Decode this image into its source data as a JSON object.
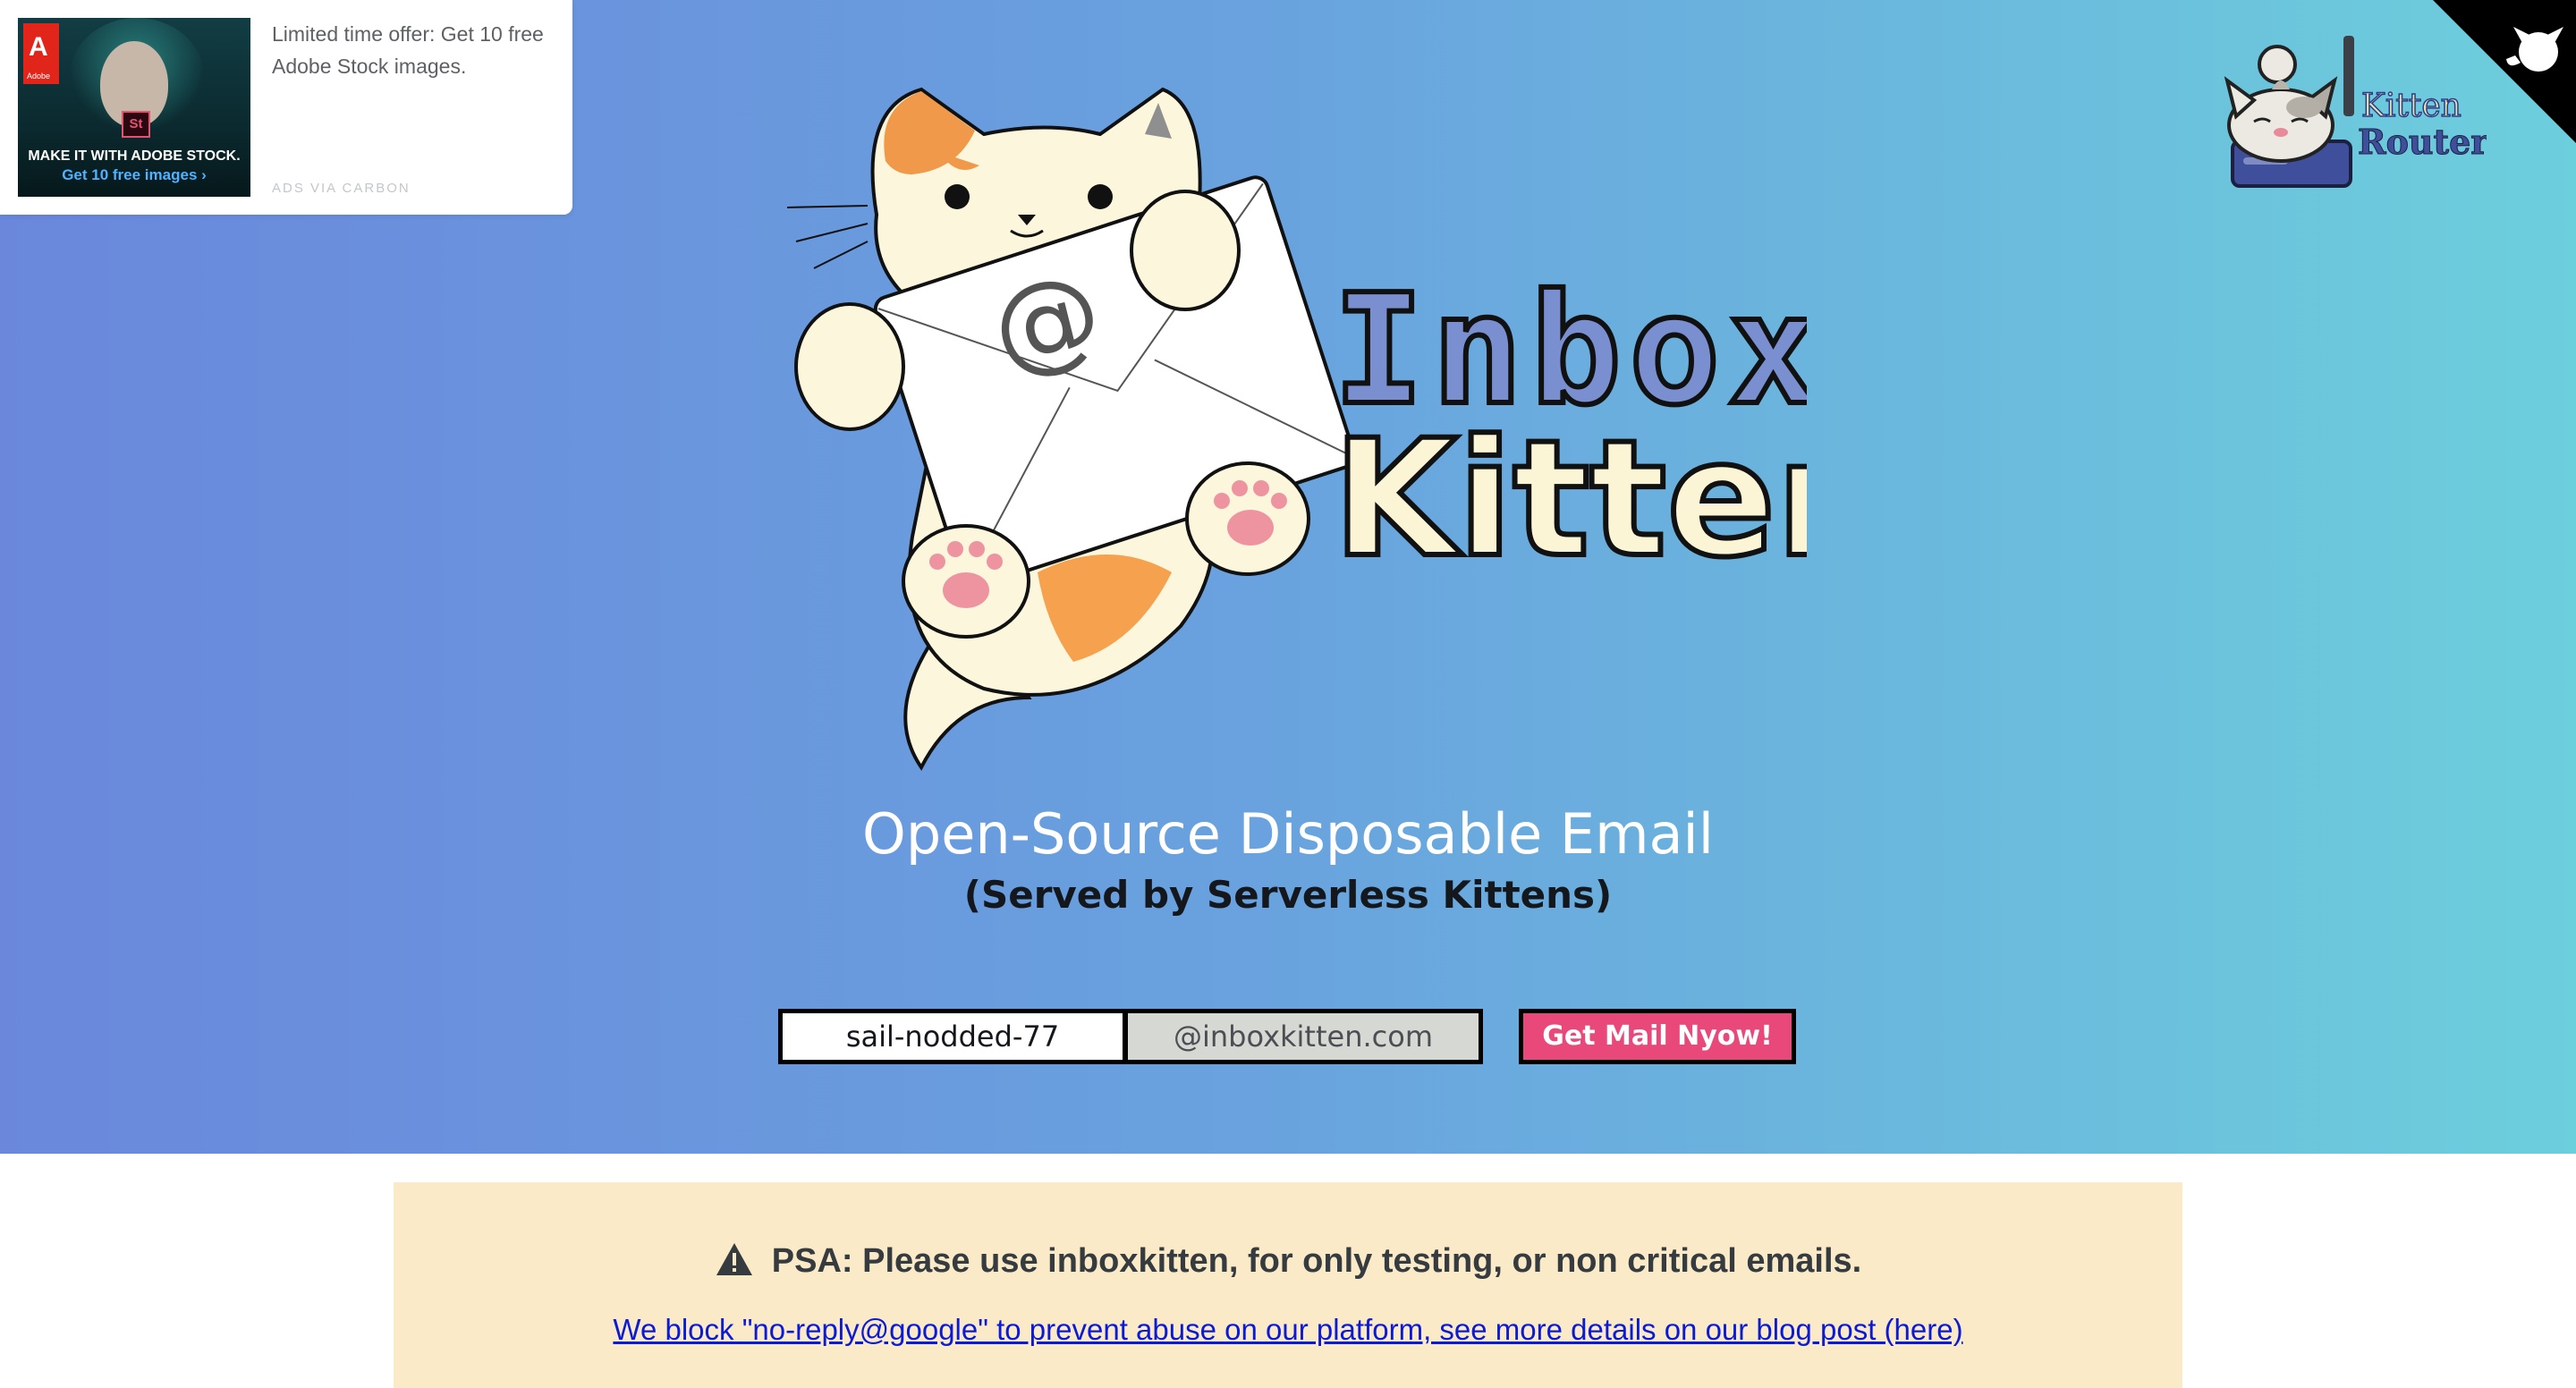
{
  "ad": {
    "text": "Limited time offer: Get 10 free Adobe Stock images.",
    "via": "ADS VIA CARBON",
    "image_line1": "MAKE IT WITH ADOBE STOCK.",
    "image_line2": "Get 10 free images ›",
    "brand": "Adobe",
    "badge": "St"
  },
  "router": {
    "line1": "Kitten",
    "line2": "Router"
  },
  "logo": {
    "word1": "Inbox",
    "word2": "Kitten",
    "at": "@"
  },
  "hero": {
    "tagline": "Open-Source Disposable Email",
    "subtagline": "(Served by Serverless Kittens)"
  },
  "form": {
    "name_value": "sail-nodded-77",
    "domain": "@inboxkitten.com",
    "button_label": "Get Mail Nyow!"
  },
  "psa": {
    "title": "PSA: Please use inboxkitten, for only testing, or non critical emails.",
    "link_text": "We block \"no-reply@google\" to prevent abuse on our platform, see more details on our blog post (here)"
  },
  "colors": {
    "gradient_start": "#6a87dc",
    "gradient_end": "#6ccfdc",
    "button": "#e9497a",
    "psa_bg": "#faeac7",
    "link": "#0a1ad6"
  },
  "icons": [
    "warning-icon",
    "github-corner-icon",
    "kitten-router-logo",
    "inbox-kitten-logo"
  ]
}
